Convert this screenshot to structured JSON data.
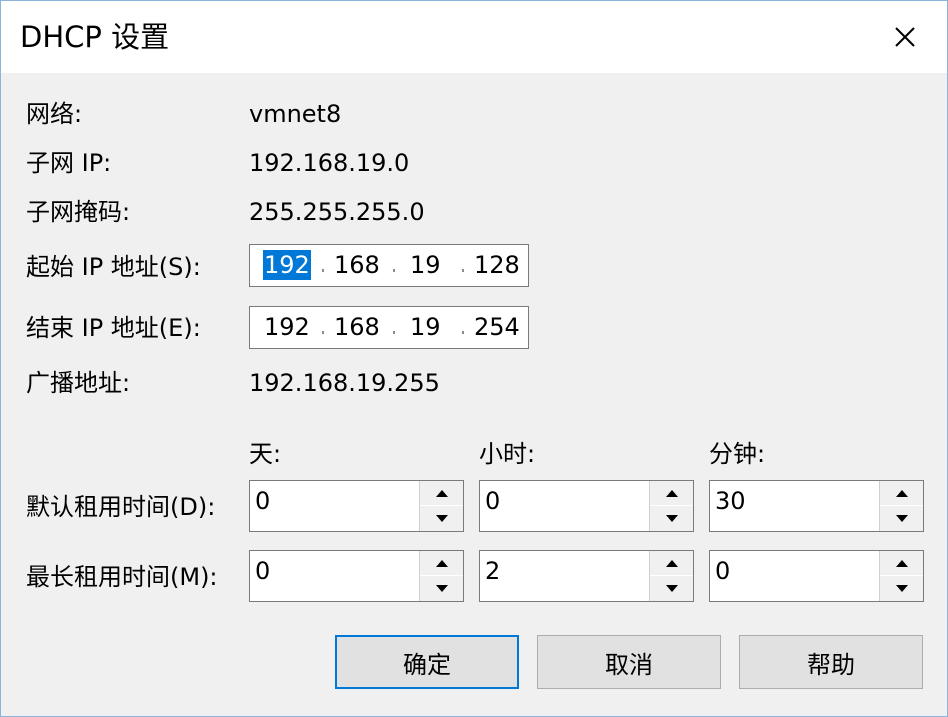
{
  "title": "DHCP 设置",
  "close_icon": "close-icon",
  "info": {
    "network_label": "网络:",
    "network_value": "vmnet8",
    "subnet_ip_label": "子网 IP:",
    "subnet_ip_value": "192.168.19.0",
    "mask_label": "子网掩码:",
    "mask_value": "255.255.255.0",
    "broadcast_label": "广播地址:",
    "broadcast_value": "192.168.19.255"
  },
  "start_ip": {
    "label": "起始 IP 地址(S):",
    "octets": [
      "192",
      "168",
      "19",
      "128"
    ]
  },
  "end_ip": {
    "label": "结束 IP 地址(E):",
    "octets": [
      "192",
      "168",
      "19",
      "254"
    ]
  },
  "lease": {
    "headers": {
      "days": "天:",
      "hours": "小时:",
      "minutes": "分钟:"
    },
    "default_label": "默认租用时间(D):",
    "default": {
      "days": "0",
      "hours": "0",
      "minutes": "30"
    },
    "max_label": "最长租用时间(M):",
    "max": {
      "days": "0",
      "hours": "2",
      "minutes": "0"
    }
  },
  "buttons": {
    "ok": "确定",
    "cancel": "取消",
    "help": "帮助"
  },
  "colors": {
    "accent": "#0078d7",
    "background": "#f0f0f0"
  }
}
